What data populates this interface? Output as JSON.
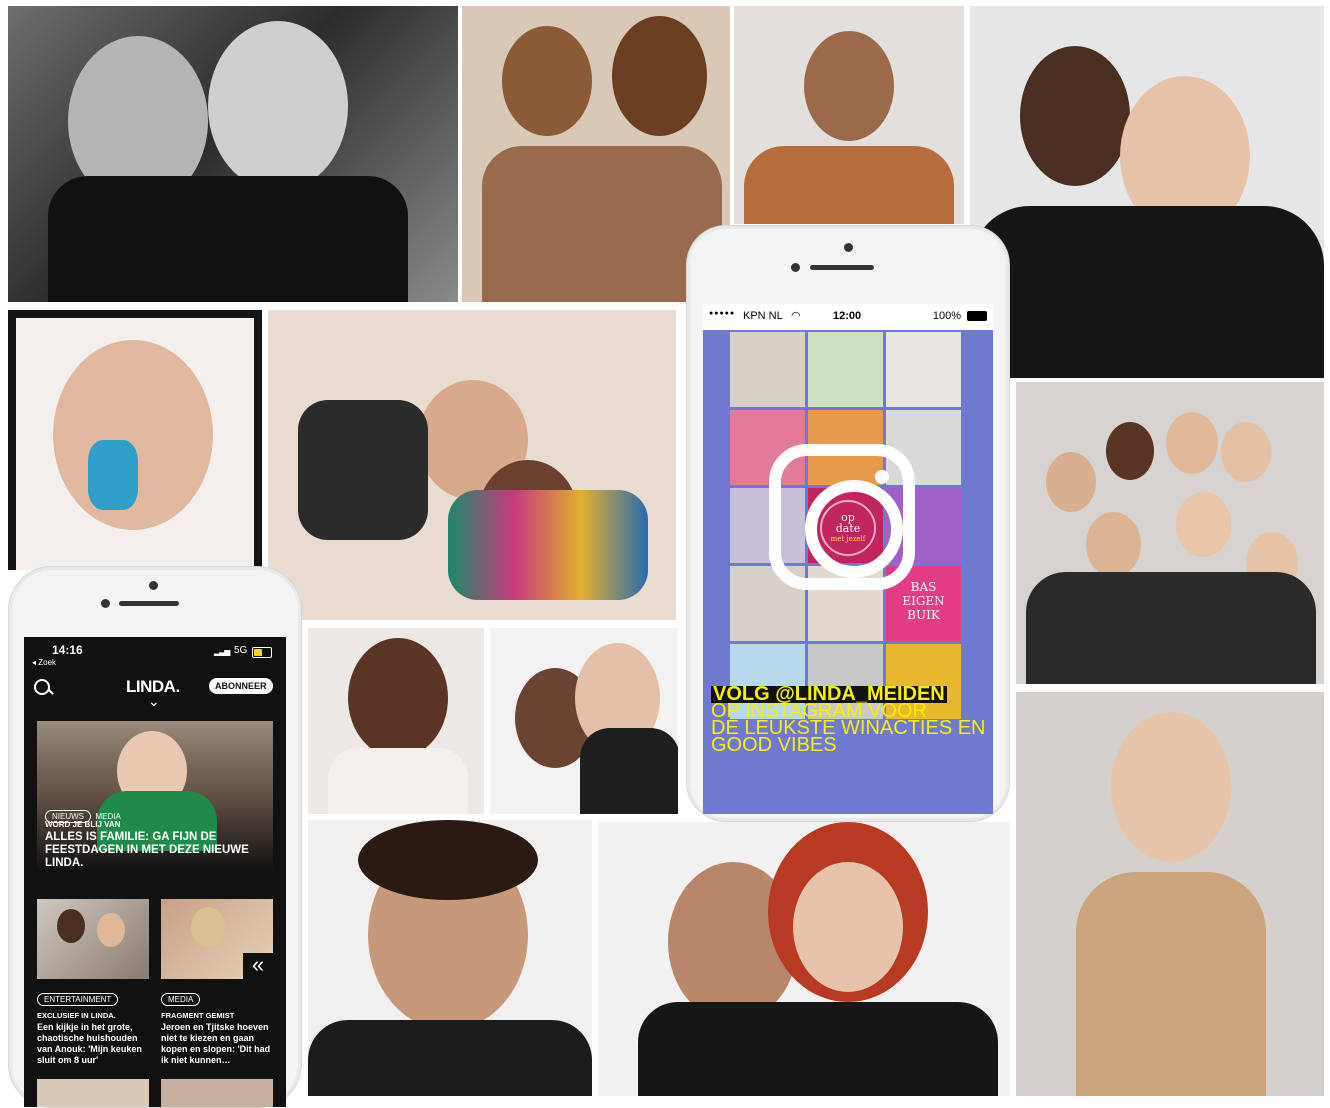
{
  "colors": {
    "black": "#111111",
    "white": "#ffffff",
    "insta_bg": "#6f79d0",
    "insta_yellow": "#f5f100",
    "insta_pink": "#c2245f"
  },
  "linda_app": {
    "status": {
      "time": "14:16",
      "back": "◂ Zoek",
      "network": "5G"
    },
    "brand": "LINDA.",
    "subscribe": "ABONNEER",
    "chevron": "⌄",
    "hero": {
      "tag_primary": "NIEUWS",
      "tag_secondary": "MEDIA",
      "kicker": "WORD JE BLIJ VAN",
      "headline": "ALLES IS FAMILIE: GA FIJN DE FEESTDAGEN IN MET DEZE NIEUWE LINDA."
    },
    "cards": [
      {
        "tag": "ENTERTAINMENT",
        "kicker": "EXCLUSIEF IN LINDA.",
        "title": "Een kijkje in het grote, chaotische huishouden van Anouk: 'Mijn keuken sluit om 8 uur'"
      },
      {
        "tag": "MEDIA",
        "kicker": "FRAGMENT GEMIST",
        "title": "Jeroen en Tjitske hoeven niet te kiezen en gaan kopen en slopen: 'Dit had ik niet kunnen…"
      }
    ],
    "rewind_icon": "«"
  },
  "insta_phone": {
    "status": {
      "signal": "●●●●●",
      "carrier": "KPN NL",
      "time": "12:00",
      "battery": "100%"
    },
    "grid_badges": {
      "opdate_line1": "op",
      "opdate_line2": "date",
      "opdate_line3": "met jezelf",
      "bump_line1": "BAS",
      "bump_line2": "EIGEN",
      "bump_line3": "BUIK"
    },
    "cta_line1": "VOLG @LINDA_MEIDEN",
    "cta_line2": "OP INSTAGRAM VOOR",
    "cta_line3": "DE LEUKSTE WINACTIES EN",
    "cta_line4": "GOOD VIBES"
  }
}
